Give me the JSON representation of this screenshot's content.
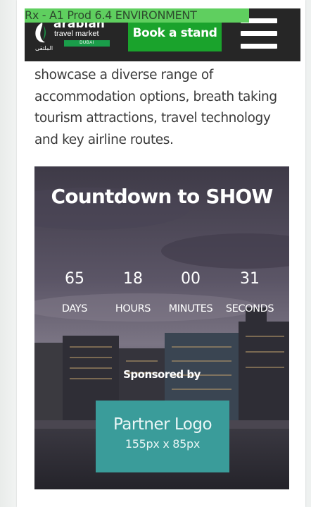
{
  "environment_banner": "Rx - A1 Prod 6.4 ENVIRONMENT",
  "header": {
    "logo": {
      "name": "arabian",
      "subtitle": "travel market",
      "location": "DUBAI",
      "arabic": "الملتقى"
    },
    "book_button_label": "Book a stand",
    "menu_icon": "hamburger-menu-icon"
  },
  "intro_text": "showcase a diverse range of accommodation options, breath taking tourism attractions, travel technology and key airline routes.",
  "countdown": {
    "title": "Countdown to SHOW",
    "units": [
      {
        "value": "65",
        "label": "DAYS"
      },
      {
        "value": "18",
        "label": "HOURS"
      },
      {
        "value": "00",
        "label": "MINUTES"
      },
      {
        "value": "31",
        "label": "SECONDS"
      }
    ],
    "sponsored_label": "Sponsored by",
    "partner_logo": {
      "title": "Partner Logo",
      "size": "155px x 85px"
    }
  },
  "colors": {
    "header_bg": "#262626",
    "accent_green": "#1aa32c",
    "banner_green": "#5fcf5f",
    "partner_teal": "#3a9c9a"
  }
}
